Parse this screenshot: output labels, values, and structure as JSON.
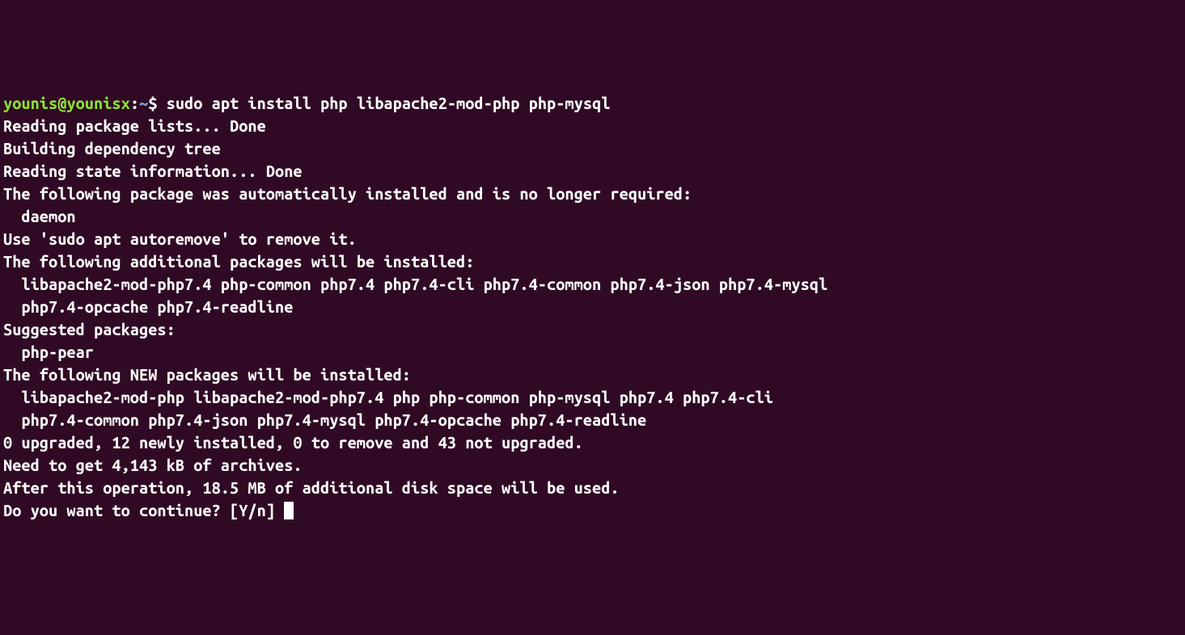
{
  "prompt": {
    "user": "younis",
    "at": "@",
    "host": "younisx",
    "colon": ":",
    "path": "~",
    "dollar": "$",
    "command": "sudo apt install php libapache2-mod-php php-mysql"
  },
  "lines": {
    "l1": "Reading package lists... Done",
    "l2": "Building dependency tree",
    "l3": "Reading state information... Done",
    "l4": "The following package was automatically installed and is no longer required:",
    "l5": "  daemon",
    "l6": "Use 'sudo apt autoremove' to remove it.",
    "l7": "The following additional packages will be installed:",
    "l8": "  libapache2-mod-php7.4 php-common php7.4 php7.4-cli php7.4-common php7.4-json php7.4-mysql",
    "l9": "  php7.4-opcache php7.4-readline",
    "l10": "Suggested packages:",
    "l11": "  php-pear",
    "l12": "The following NEW packages will be installed:",
    "l13": "  libapache2-mod-php libapache2-mod-php7.4 php php-common php-mysql php7.4 php7.4-cli",
    "l14": "  php7.4-common php7.4-json php7.4-mysql php7.4-opcache php7.4-readline",
    "l15": "0 upgraded, 12 newly installed, 0 to remove and 43 not upgraded.",
    "l16": "Need to get 4,143 kB of archives.",
    "l17": "After this operation, 18.5 MB of additional disk space will be used.",
    "l18": "Do you want to continue? [Y/n] "
  }
}
